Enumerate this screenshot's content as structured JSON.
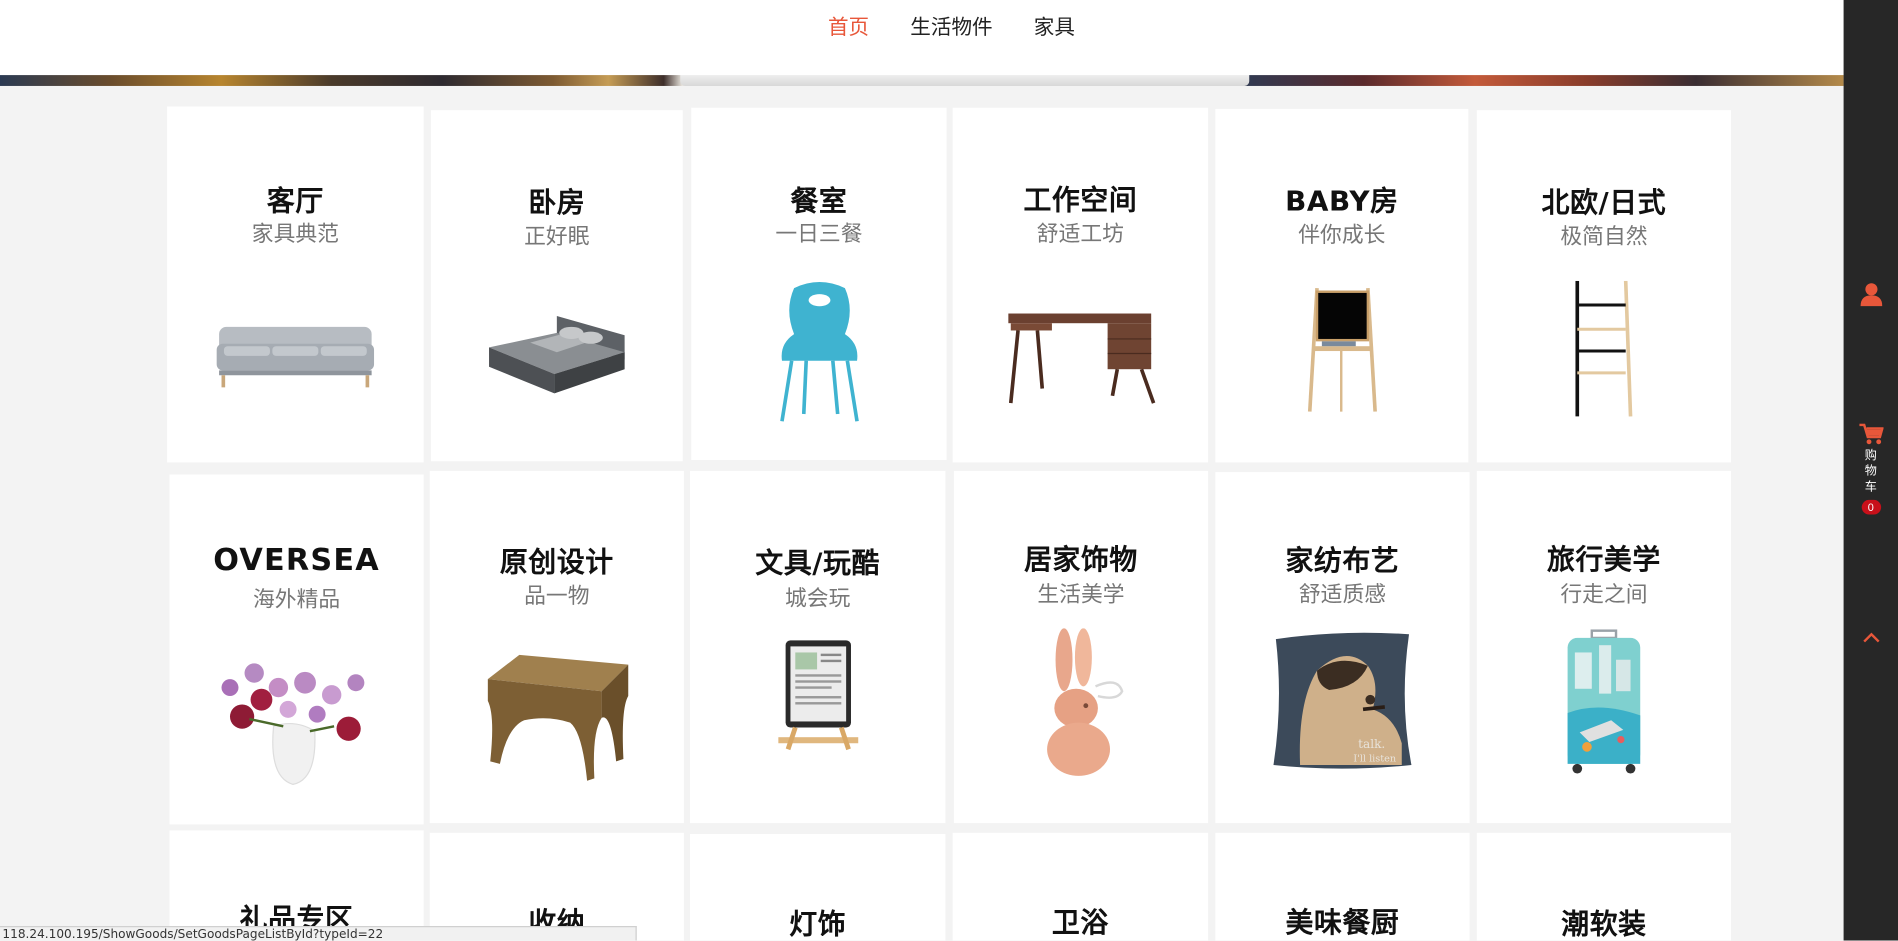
{
  "nav": {
    "items": [
      {
        "label": "首页",
        "active": true
      },
      {
        "label": "生活物件",
        "active": false
      },
      {
        "label": "家具",
        "active": false
      }
    ]
  },
  "categories": [
    {
      "title": "客厅",
      "subtitle": "家具典范",
      "icon": "sofa"
    },
    {
      "title": "卧房",
      "subtitle": "正好眠",
      "icon": "bed"
    },
    {
      "title": "餐室",
      "subtitle": "一日三餐",
      "icon": "chair"
    },
    {
      "title": "工作空间",
      "subtitle": "舒适工坊",
      "icon": "desk"
    },
    {
      "title": "BABY房",
      "subtitle": "伴你成长",
      "icon": "easel-board"
    },
    {
      "title": "北欧/日式",
      "subtitle": "极简自然",
      "icon": "ladder-rack"
    },
    {
      "title": "OVERSEA",
      "subtitle": "海外精品",
      "icon": "flower-vase"
    },
    {
      "title": "原创设计",
      "subtitle": "品一物",
      "icon": "side-table"
    },
    {
      "title": "文具/玩酷",
      "subtitle": "城会玩",
      "icon": "tablet-stand"
    },
    {
      "title": "居家饰物",
      "subtitle": "生活美学",
      "icon": "rabbit-ornament"
    },
    {
      "title": "家纺布艺",
      "subtitle": "舒适质感",
      "icon": "pillow"
    },
    {
      "title": "旅行美学",
      "subtitle": "行走之间",
      "icon": "suitcase"
    },
    {
      "title": "礼品专区",
      "subtitle": "",
      "icon": ""
    },
    {
      "title": "收纳",
      "subtitle": "",
      "icon": ""
    },
    {
      "title": "灯饰",
      "subtitle": "",
      "icon": ""
    },
    {
      "title": "卫浴",
      "subtitle": "",
      "icon": ""
    },
    {
      "title": "美味餐厨",
      "subtitle": "",
      "icon": ""
    },
    {
      "title": "潮软装",
      "subtitle": "",
      "icon": ""
    }
  ],
  "pillow_text": {
    "line1": "talk.",
    "line2": "I'll listen"
  },
  "sidebar": {
    "cart_label": "购物车",
    "cart_count": "0"
  },
  "status_url": "118.24.100.195/ShowGoods/SetGoodsPageListById?typeId=22",
  "colors": {
    "accent": "#e8573a",
    "sidebar_bg": "#272727",
    "badge": "#c8101a",
    "page_bg": "#f3f3f3"
  }
}
